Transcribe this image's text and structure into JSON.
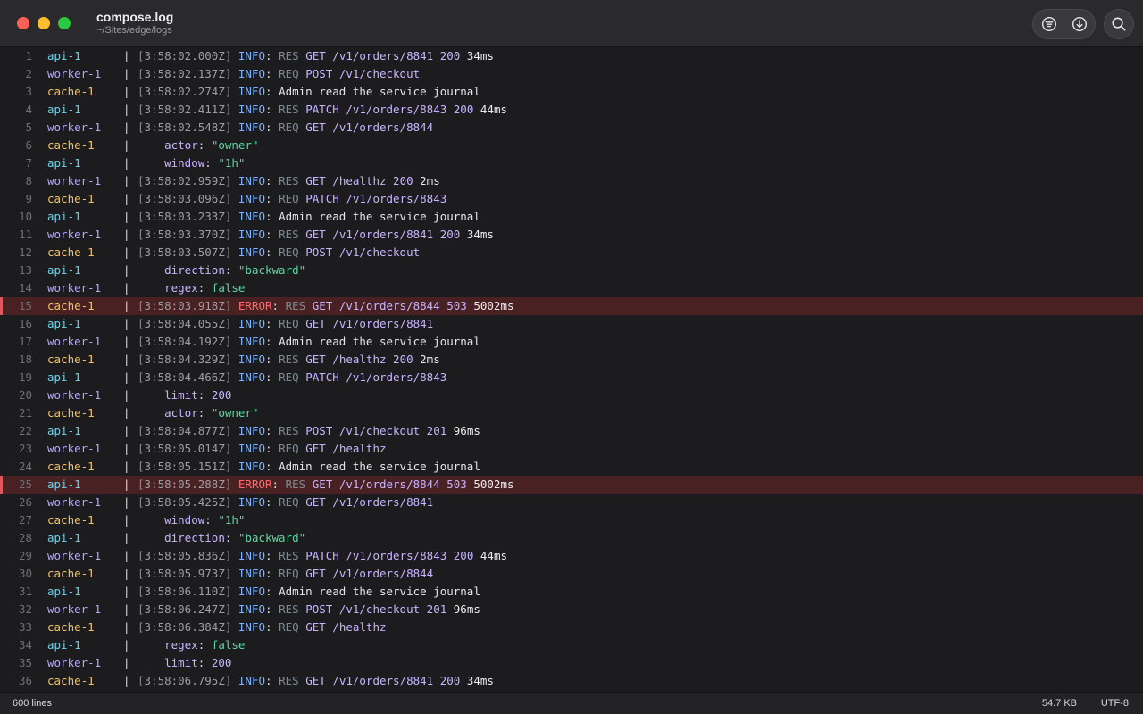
{
  "window": {
    "title": "compose.log",
    "subtitle": "~/Sites/edge/logs"
  },
  "toolbar": {
    "filter_icon": "filter-icon",
    "download_icon": "download-icon",
    "search_icon": "search-icon"
  },
  "colors": {
    "error_row": "#4a2123",
    "api": "#6fd2e8",
    "worker": "#b4a8f5",
    "cache": "#f0c36a"
  },
  "lines": [
    {
      "n": "1",
      "svc": "api-1",
      "kind": "entry",
      "ts": "3:58:02.000Z",
      "level": "INFO",
      "event": "RES",
      "method": "GET",
      "path": "/v1/orders/8841",
      "status": "200",
      "dur": "34ms"
    },
    {
      "n": "2",
      "svc": "worker-1",
      "kind": "entry",
      "ts": "3:58:02.137Z",
      "level": "INFO",
      "event": "REQ",
      "method": "POST",
      "path": "/v1/checkout"
    },
    {
      "n": "3",
      "svc": "cache-1",
      "kind": "entry",
      "ts": "3:58:02.274Z",
      "level": "INFO",
      "text": "Admin read the service journal"
    },
    {
      "n": "4",
      "svc": "api-1",
      "kind": "entry",
      "ts": "3:58:02.411Z",
      "level": "INFO",
      "event": "RES",
      "method": "PATCH",
      "path": "/v1/orders/8843",
      "status": "200",
      "dur": "44ms"
    },
    {
      "n": "5",
      "svc": "worker-1",
      "kind": "entry",
      "ts": "3:58:02.548Z",
      "level": "INFO",
      "event": "REQ",
      "method": "GET",
      "path": "/v1/orders/8844"
    },
    {
      "n": "6",
      "svc": "cache-1",
      "kind": "field",
      "key": "actor",
      "value": "\"owner\"",
      "vtype": "str"
    },
    {
      "n": "7",
      "svc": "api-1",
      "kind": "field",
      "key": "window",
      "value": "\"1h\"",
      "vtype": "str"
    },
    {
      "n": "8",
      "svc": "worker-1",
      "kind": "entry",
      "ts": "3:58:02.959Z",
      "level": "INFO",
      "event": "RES",
      "method": "GET",
      "path": "/healthz",
      "status": "200",
      "dur": "2ms"
    },
    {
      "n": "9",
      "svc": "cache-1",
      "kind": "entry",
      "ts": "3:58:03.096Z",
      "level": "INFO",
      "event": "REQ",
      "method": "PATCH",
      "path": "/v1/orders/8843"
    },
    {
      "n": "10",
      "svc": "api-1",
      "kind": "entry",
      "ts": "3:58:03.233Z",
      "level": "INFO",
      "text": "Admin read the service journal"
    },
    {
      "n": "11",
      "svc": "worker-1",
      "kind": "entry",
      "ts": "3:58:03.370Z",
      "level": "INFO",
      "event": "RES",
      "method": "GET",
      "path": "/v1/orders/8841",
      "status": "200",
      "dur": "34ms"
    },
    {
      "n": "12",
      "svc": "cache-1",
      "kind": "entry",
      "ts": "3:58:03.507Z",
      "level": "INFO",
      "event": "REQ",
      "method": "POST",
      "path": "/v1/checkout"
    },
    {
      "n": "13",
      "svc": "api-1",
      "kind": "field",
      "key": "direction",
      "value": "\"backward\"",
      "vtype": "str"
    },
    {
      "n": "14",
      "svc": "worker-1",
      "kind": "field",
      "key": "regex",
      "value": "false",
      "vtype": "str"
    },
    {
      "n": "15",
      "svc": "cache-1",
      "kind": "entry",
      "ts": "3:58:03.918Z",
      "level": "ERROR",
      "event": "RES",
      "method": "GET",
      "path": "/v1/orders/8844",
      "status": "503",
      "dur": "5002ms"
    },
    {
      "n": "16",
      "svc": "api-1",
      "kind": "entry",
      "ts": "3:58:04.055Z",
      "level": "INFO",
      "event": "REQ",
      "method": "GET",
      "path": "/v1/orders/8841"
    },
    {
      "n": "17",
      "svc": "worker-1",
      "kind": "entry",
      "ts": "3:58:04.192Z",
      "level": "INFO",
      "text": "Admin read the service journal"
    },
    {
      "n": "18",
      "svc": "cache-1",
      "kind": "entry",
      "ts": "3:58:04.329Z",
      "level": "INFO",
      "event": "RES",
      "method": "GET",
      "path": "/healthz",
      "status": "200",
      "dur": "2ms"
    },
    {
      "n": "19",
      "svc": "api-1",
      "kind": "entry",
      "ts": "3:58:04.466Z",
      "level": "INFO",
      "event": "REQ",
      "method": "PATCH",
      "path": "/v1/orders/8843"
    },
    {
      "n": "20",
      "svc": "worker-1",
      "kind": "field",
      "key": "limit",
      "value": "200",
      "vtype": "num"
    },
    {
      "n": "21",
      "svc": "cache-1",
      "kind": "field",
      "key": "actor",
      "value": "\"owner\"",
      "vtype": "str"
    },
    {
      "n": "22",
      "svc": "api-1",
      "kind": "entry",
      "ts": "3:58:04.877Z",
      "level": "INFO",
      "event": "RES",
      "method": "POST",
      "path": "/v1/checkout",
      "status": "201",
      "dur": "96ms"
    },
    {
      "n": "23",
      "svc": "worker-1",
      "kind": "entry",
      "ts": "3:58:05.014Z",
      "level": "INFO",
      "event": "REQ",
      "method": "GET",
      "path": "/healthz"
    },
    {
      "n": "24",
      "svc": "cache-1",
      "kind": "entry",
      "ts": "3:58:05.151Z",
      "level": "INFO",
      "text": "Admin read the service journal"
    },
    {
      "n": "25",
      "svc": "api-1",
      "kind": "entry",
      "ts": "3:58:05.288Z",
      "level": "ERROR",
      "event": "RES",
      "method": "GET",
      "path": "/v1/orders/8844",
      "status": "503",
      "dur": "5002ms"
    },
    {
      "n": "26",
      "svc": "worker-1",
      "kind": "entry",
      "ts": "3:58:05.425Z",
      "level": "INFO",
      "event": "REQ",
      "method": "GET",
      "path": "/v1/orders/8841"
    },
    {
      "n": "27",
      "svc": "cache-1",
      "kind": "field",
      "key": "window",
      "value": "\"1h\"",
      "vtype": "str"
    },
    {
      "n": "28",
      "svc": "api-1",
      "kind": "field",
      "key": "direction",
      "value": "\"backward\"",
      "vtype": "str"
    },
    {
      "n": "29",
      "svc": "worker-1",
      "kind": "entry",
      "ts": "3:58:05.836Z",
      "level": "INFO",
      "event": "RES",
      "method": "PATCH",
      "path": "/v1/orders/8843",
      "status": "200",
      "dur": "44ms"
    },
    {
      "n": "30",
      "svc": "cache-1",
      "kind": "entry",
      "ts": "3:58:05.973Z",
      "level": "INFO",
      "event": "REQ",
      "method": "GET",
      "path": "/v1/orders/8844"
    },
    {
      "n": "31",
      "svc": "api-1",
      "kind": "entry",
      "ts": "3:58:06.110Z",
      "level": "INFO",
      "text": "Admin read the service journal"
    },
    {
      "n": "32",
      "svc": "worker-1",
      "kind": "entry",
      "ts": "3:58:06.247Z",
      "level": "INFO",
      "event": "RES",
      "method": "POST",
      "path": "/v1/checkout",
      "status": "201",
      "dur": "96ms"
    },
    {
      "n": "33",
      "svc": "cache-1",
      "kind": "entry",
      "ts": "3:58:06.384Z",
      "level": "INFO",
      "event": "REQ",
      "method": "GET",
      "path": "/healthz"
    },
    {
      "n": "34",
      "svc": "api-1",
      "kind": "field",
      "key": "regex",
      "value": "false",
      "vtype": "str"
    },
    {
      "n": "35",
      "svc": "worker-1",
      "kind": "field",
      "key": "limit",
      "value": "200",
      "vtype": "num"
    },
    {
      "n": "36",
      "svc": "cache-1",
      "kind": "entry",
      "ts": "3:58:06.795Z",
      "level": "INFO",
      "event": "RES",
      "method": "GET",
      "path": "/v1/orders/8841",
      "status": "200",
      "dur": "34ms"
    }
  ],
  "statusbar": {
    "line_count": "600 lines",
    "file_size": "54.7 KB",
    "encoding": "UTF-8"
  }
}
